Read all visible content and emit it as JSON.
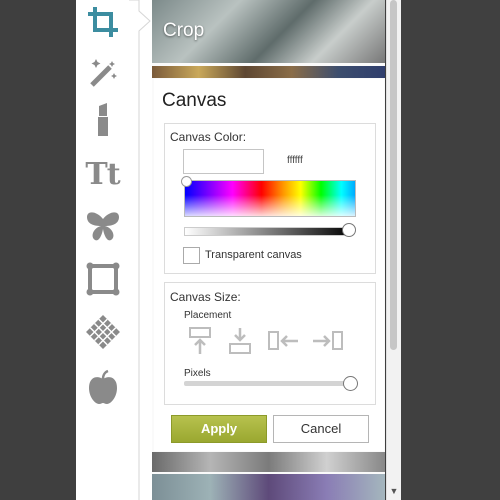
{
  "toolbar": {
    "tools": [
      {
        "name": "crop-icon"
      },
      {
        "name": "magic-wand-icon"
      },
      {
        "name": "lipstick-icon"
      },
      {
        "name": "text-icon",
        "glyph": "Tt"
      },
      {
        "name": "butterfly-icon"
      },
      {
        "name": "frame-icon"
      },
      {
        "name": "texture-icon"
      },
      {
        "name": "apple-icon"
      }
    ],
    "active_color": "#3c8da0",
    "icon_color": "#8a8a8a"
  },
  "thumbnails": {
    "crop_label": "Crop"
  },
  "panel": {
    "title": "Canvas",
    "canvas_color": {
      "label": "Canvas Color:",
      "input_value": "",
      "hex_value": "ffffff",
      "transparent_label": "Transparent canvas",
      "transparent_checked": false
    },
    "canvas_size": {
      "label": "Canvas Size:",
      "placement_label": "Placement",
      "placement_icons": [
        "placement-top-icon",
        "placement-bottom-icon",
        "placement-left-icon",
        "placement-right-icon"
      ],
      "pixels_label": "Pixels",
      "pixels_level": 1.0
    },
    "apply_label": "Apply",
    "cancel_label": "Cancel",
    "apply_color": "#a4b13a"
  }
}
